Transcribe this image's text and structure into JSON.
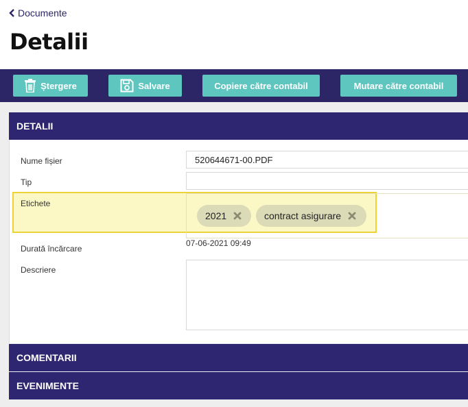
{
  "nav": {
    "back_label": "Documente"
  },
  "page": {
    "title": "Detalii"
  },
  "toolbar": {
    "delete_label": "Ștergere",
    "save_label": "Salvare",
    "copy_label": "Copiere către contabil",
    "move_label": "Mutare către contabil"
  },
  "details": {
    "header": "DETALII",
    "fields": {
      "filename_label": "Nume fișier",
      "filename_value": "520644671-00.PDF",
      "type_label": "Tip",
      "type_value": "",
      "tags_label": "Etichete",
      "tags": [
        "2021",
        "contract asigurare"
      ],
      "upload_label": "Durată încărcare",
      "upload_value": "07-06-2021 09:49",
      "description_label": "Descriere",
      "description_value": ""
    }
  },
  "comments": {
    "header": "COMENTARII"
  },
  "events": {
    "header": "EVENIMENTE"
  },
  "colors": {
    "toolbar_bg": "#2c2566",
    "button_bg": "#5fc5bf",
    "panel_header_bg": "#2e2670",
    "highlight_bg": "#fbf8c6",
    "highlight_border": "#ecd33a",
    "chip_bg": "#dcdbb8"
  },
  "icons": {
    "back": "chevron-left-icon",
    "delete": "trash-icon",
    "save": "floppy-disk-icon",
    "tag_remove": "close-icon"
  }
}
